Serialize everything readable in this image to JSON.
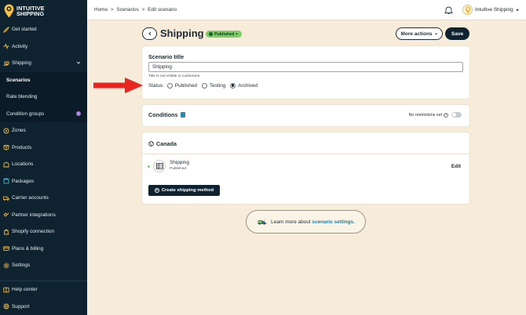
{
  "brand": {
    "line1": "INTUITIVE",
    "line2": "SHIPPING"
  },
  "sidebar": {
    "items": [
      {
        "label": "Get started",
        "icon": "rocket-icon"
      },
      {
        "label": "Activity",
        "icon": "activity-icon"
      },
      {
        "label": "Shipping",
        "icon": "shipping-icon",
        "expanded": true
      },
      {
        "label": "Scenarios",
        "sub": true,
        "active": true
      },
      {
        "label": "Rate blending",
        "sub": true
      },
      {
        "label": "Condition groups",
        "sub": true,
        "badge": "i"
      },
      {
        "label": "Zones",
        "icon": "zones-icon"
      },
      {
        "label": "Products",
        "icon": "products-icon"
      },
      {
        "label": "Locations",
        "icon": "locations-icon"
      },
      {
        "label": "Packages",
        "icon": "packages-icon"
      },
      {
        "label": "Carrier accounts",
        "icon": "carrier-icon"
      },
      {
        "label": "Partner integrations",
        "icon": "partner-icon"
      },
      {
        "label": "Shopify connection",
        "icon": "shopify-icon"
      },
      {
        "label": "Plans & billing",
        "icon": "billing-icon"
      },
      {
        "label": "Settings",
        "icon": "gear-icon"
      }
    ],
    "bottom": [
      {
        "label": "Help center",
        "icon": "help-icon"
      },
      {
        "label": "Support",
        "icon": "support-icon"
      }
    ]
  },
  "topbar": {
    "breadcrumb": [
      "Home",
      "Scenarios",
      "Edit scenario"
    ],
    "separator": ">",
    "account_name": "Intuitive Shipping"
  },
  "header": {
    "title": "Shipping",
    "status_badge": "Published",
    "more_actions": "More actions",
    "save": "Save"
  },
  "scenario": {
    "title_label": "Scenario title",
    "title_value": "Shipping",
    "helper": "Title is not visible to customers.",
    "status_label": "Status:",
    "options": [
      "Published",
      "Testing",
      "Archived"
    ],
    "selected": "Archived"
  },
  "conditions": {
    "title": "Conditions",
    "restriction_text": "No restrictions set"
  },
  "region": {
    "name": "Canada",
    "method_name": "Shipping",
    "method_status": "Published",
    "edit": "Edit",
    "create_button": "Create shipping method"
  },
  "learn_more": {
    "text": "Learn more about",
    "link": "scenario settings."
  },
  "colors": {
    "sidebar": "#0e2230",
    "accent": "#f4c14a",
    "published": "#7ccc6a",
    "annotation_arrow": "#e8261f"
  }
}
